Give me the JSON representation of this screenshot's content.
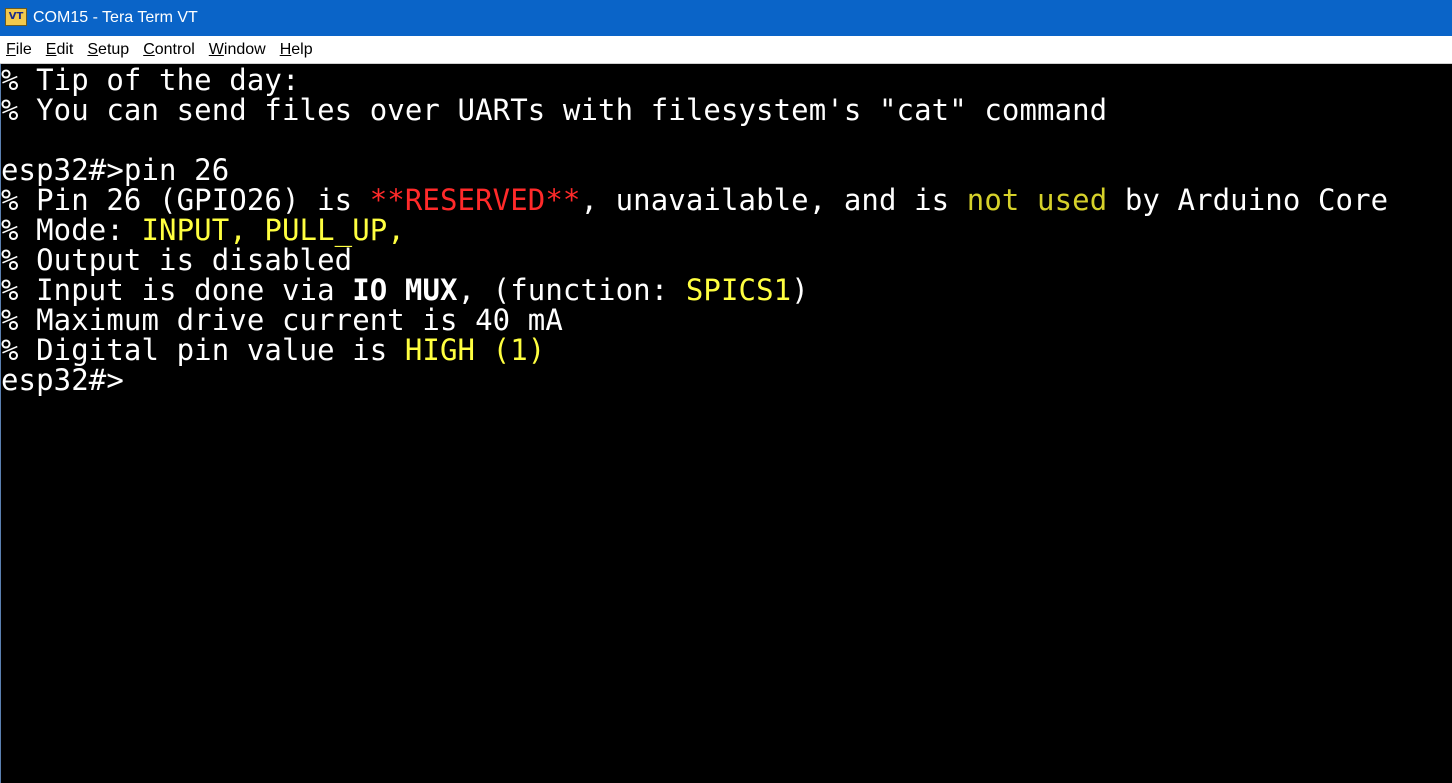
{
  "window": {
    "title": "COM15 - Tera Term VT",
    "icon_label": "VT",
    "icon_name": "tera-term-vt-icon"
  },
  "menu": {
    "items": [
      {
        "accel": "F",
        "rest": "ile"
      },
      {
        "accel": "E",
        "rest": "dit"
      },
      {
        "accel": "S",
        "rest": "etup"
      },
      {
        "accel": "C",
        "rest": "ontrol"
      },
      {
        "accel": "W",
        "rest": "indow"
      },
      {
        "accel": "H",
        "rest": "elp"
      }
    ]
  },
  "colors": {
    "titlebar": "#0a64c8",
    "terminal_bg": "#000000",
    "terminal_fg": "#ffffff",
    "reserved_red": "#ff2a2a",
    "not_used_olive": "#d6d12a",
    "highlight_yellow": "#ffff40"
  },
  "terminal": {
    "lines": [
      {
        "segments": [
          {
            "text": "% Tip of the day:",
            "style": ""
          }
        ]
      },
      {
        "segments": [
          {
            "text": "% You can send files over UARTs with filesystem's \"cat\" command",
            "style": ""
          }
        ]
      },
      {
        "segments": [
          {
            "text": "",
            "style": ""
          }
        ]
      },
      {
        "segments": [
          {
            "text": "esp32#>pin 26",
            "style": ""
          }
        ]
      },
      {
        "segments": [
          {
            "text": "% Pin 26 (GPIO26) is ",
            "style": ""
          },
          {
            "text": "**RESERVED**",
            "style": "red"
          },
          {
            "text": ", unavailable, and is ",
            "style": ""
          },
          {
            "text": "not used",
            "style": "olive"
          },
          {
            "text": " by Arduino Core",
            "style": ""
          }
        ]
      },
      {
        "segments": [
          {
            "text": "% Mode: ",
            "style": ""
          },
          {
            "text": "INPUT, PULL_UP,",
            "style": "yellow"
          }
        ]
      },
      {
        "segments": [
          {
            "text": "% Output is disabled",
            "style": ""
          }
        ]
      },
      {
        "segments": [
          {
            "text": "% Input is done via ",
            "style": ""
          },
          {
            "text": "IO MUX",
            "style": "bold"
          },
          {
            "text": ", (function: ",
            "style": ""
          },
          {
            "text": "SPICS1",
            "style": "yellow"
          },
          {
            "text": ")",
            "style": ""
          }
        ]
      },
      {
        "segments": [
          {
            "text": "% Maximum drive current is 40 mA",
            "style": ""
          }
        ]
      },
      {
        "segments": [
          {
            "text": "% Digital pin value is ",
            "style": ""
          },
          {
            "text": "HIGH (1)",
            "style": "yellow"
          }
        ]
      },
      {
        "segments": [
          {
            "text": "esp32#>",
            "style": ""
          }
        ]
      }
    ]
  }
}
